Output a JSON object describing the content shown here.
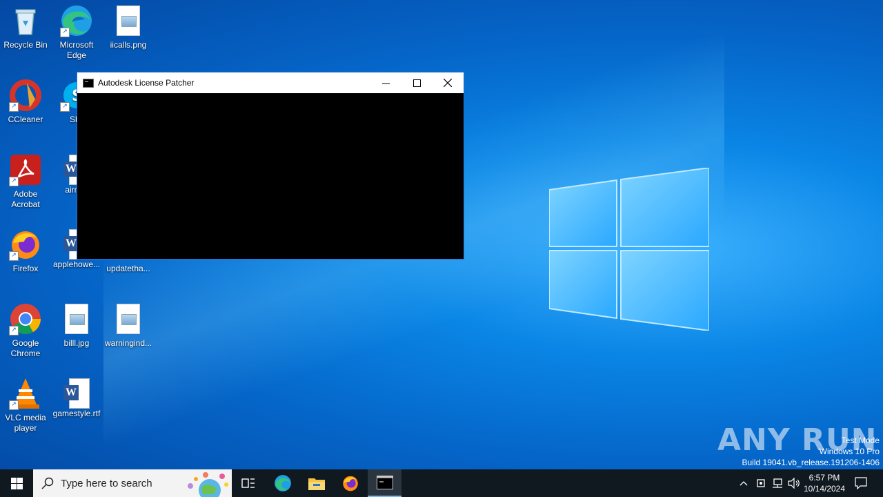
{
  "desktop": {
    "icons": [
      {
        "label": "Recycle Bin"
      },
      {
        "label": "Microsoft Edge"
      },
      {
        "label": "iicalls.png"
      },
      {
        "label": "CCleaner"
      },
      {
        "label": "Sky"
      },
      {
        "label": "Adobe Acrobat"
      },
      {
        "label": "airmat"
      },
      {
        "label": "Firefox"
      },
      {
        "label": "applehowe..."
      },
      {
        "label": "updatetha..."
      },
      {
        "label": "Google Chrome"
      },
      {
        "label": "billl.jpg"
      },
      {
        "label": "warningind..."
      },
      {
        "label": "VLC media player"
      },
      {
        "label": "gamestyle.rtf"
      }
    ]
  },
  "window": {
    "title": "Autodesk License Patcher",
    "minimize": "—",
    "maximize": "☐",
    "close": "✕"
  },
  "taskbar": {
    "search_placeholder": "Type here to search",
    "time": "6:57 PM",
    "date": "10/14/2024"
  },
  "watermark": {
    "brand": "ANY RUN",
    "line1": "Test Mode",
    "line2": "Windows 10 Pro",
    "line3": "Build 19041.vb_release.191206-1406"
  },
  "colors": {
    "accent": "#0a86e6",
    "taskbar": "#101820",
    "active_border": "#2b70d8"
  }
}
